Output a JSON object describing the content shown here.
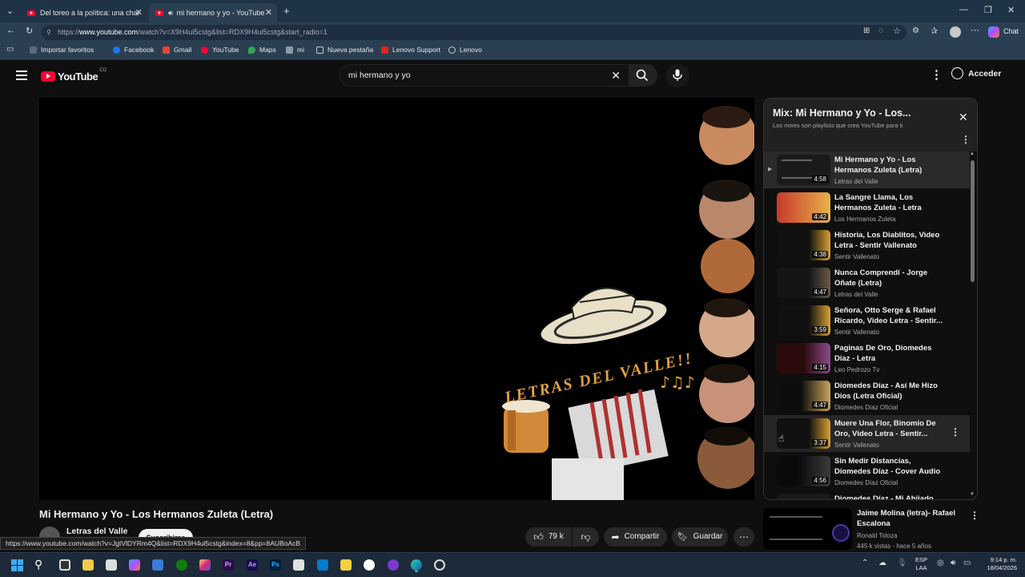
{
  "browser": {
    "tabs": [
      {
        "title": "Del toreo a la política: una charla :"
      },
      {
        "title": "mi hermano y yo - YouTube"
      }
    ],
    "url_prefix": "https://",
    "url_host": "www.youtube.com",
    "url_path": "/watch?v=X9H4ul5cstg&list=RDX9H4ul5cstg&start_radio=1",
    "chat_label": "Chat",
    "bookmarks": [
      {
        "label": "Importar favoritos",
        "icon": "import-icon"
      },
      {
        "label": "Facebook",
        "icon": "facebook-icon"
      },
      {
        "label": "Gmail",
        "icon": "gmail-icon"
      },
      {
        "label": "YouTube",
        "icon": "youtube-icon"
      },
      {
        "label": "Maps",
        "icon": "maps-icon"
      },
      {
        "label": "mi",
        "icon": "folder-icon"
      },
      {
        "label": "Nueva pestaña",
        "icon": "tab-icon"
      },
      {
        "label": "Lenovo Support",
        "icon": "lenovo-icon"
      },
      {
        "label": "Lenovo",
        "icon": "globe-icon"
      }
    ]
  },
  "header": {
    "logo": "YouTube",
    "country": "CO",
    "search_value": "mi hermano y yo",
    "signin": "Acceder"
  },
  "video": {
    "overlay_text": "LETRAS DEL VALLE!!",
    "title": "Mi Hermano y Yo - Los Hermanos Zuleta (Letra)",
    "channel": "Letras del Valle",
    "subscribe": "Suscribirse",
    "likes": "79 k",
    "share": "Compartir",
    "save": "Guardar"
  },
  "playlist": {
    "title": "Mix: Mi Hermano y Yo - Los...",
    "subtitle": "Los mixes son playlists que crea YouTube para ti",
    "items": [
      {
        "title": "Mi Hermano y Yo - Los Hermanos Zuleta (Letra)",
        "channel": "Letras del Valle",
        "duration": "4:58"
      },
      {
        "title": "La Sangre Llama, Los Hermanos Zuleta - Letra Oficial",
        "channel": "Los Hermanos Zuleta",
        "duration": "4:42"
      },
      {
        "title": "Historia, Los Diablitos, Video Letra - Sentir Vallenato",
        "channel": "Sentir Vallenato",
        "duration": "4:38"
      },
      {
        "title": "Nunca Comprendí - Jorge Oñate (Letra)",
        "channel": "Letras del Valle",
        "duration": "4:47"
      },
      {
        "title": "Señora, Otto Serge & Rafael Ricardo, Video Letra - Sentir...",
        "channel": "Sentir Vallenato",
        "duration": "3:59"
      },
      {
        "title": "Paginas De Oro, Diomedes Diaz - Letra",
        "channel": "Leo Pedrozo Tv",
        "duration": "4:15"
      },
      {
        "title": "Diomedes Díaz - Así Me Hizo Dios (Letra Oficial)",
        "channel": "Diomedes Díaz Oficial",
        "duration": "4:47"
      },
      {
        "title": "Muere Una Flor, Binomio De Oro, Video Letra - Sentir...",
        "channel": "Sentir Vallenato",
        "duration": "3:37"
      },
      {
        "title": "Sin Medir Distancias, Diomedes Díaz - Cover Audio",
        "channel": "Diomedes Díaz Oficial",
        "duration": "4:56"
      },
      {
        "title": "Diomedes Díaz - Mi Ahijado",
        "channel": "",
        "duration": ""
      }
    ]
  },
  "recommendation": {
    "title": "Jaime Molina (letra)- Rafael Escalona",
    "channel": "Ronald Toloza",
    "meta": "445 k vistas - hace 5 años"
  },
  "status_url": "https://www.youtube.com/watch?v=JgtVlDYRm4Q&list=RDX9H4ul5cstg&index=8&pp=8AUBoAcB",
  "taskbar": {
    "lang": "ESP",
    "lang2": "LAA",
    "time": "9:14 p. m.",
    "date": "18/04/2026"
  }
}
